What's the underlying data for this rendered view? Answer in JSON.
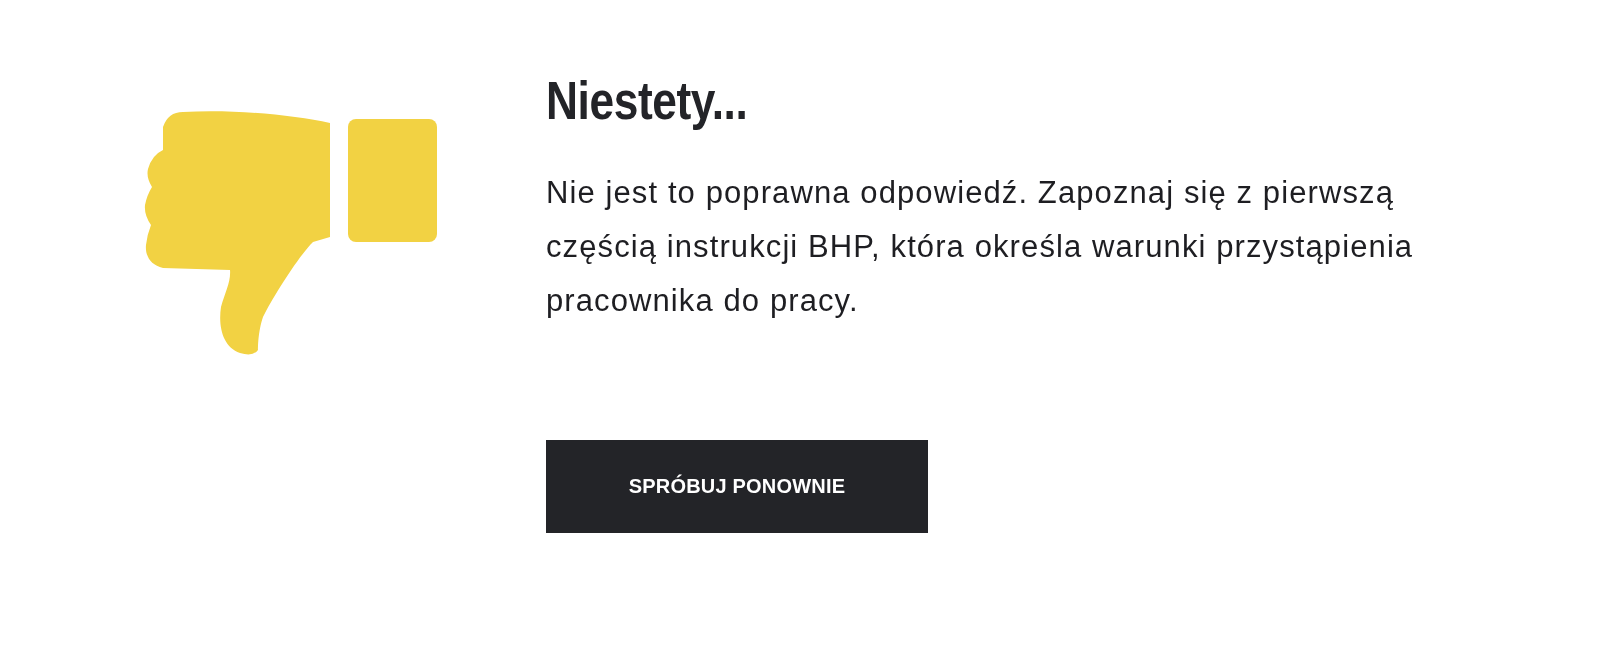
{
  "feedback": {
    "title": "Niestety...",
    "message": "Nie jest to poprawna odpowiedź. Zapoznaj się z pierwszą częścią instrukcji BHP, która określa warunki przystąpienia pracownika do pracy."
  },
  "button": {
    "label": "SPRÓBUJ PONOWNIE"
  }
}
